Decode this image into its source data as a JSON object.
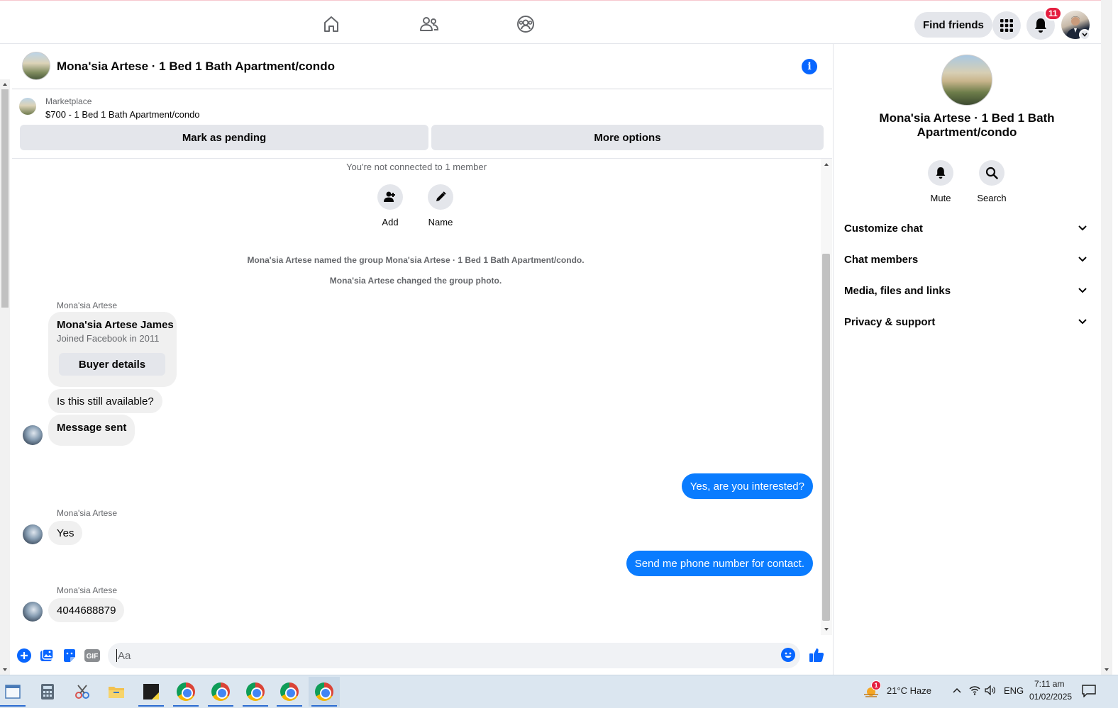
{
  "topnav": {
    "find_friends": "Find friends",
    "notification_count": "11"
  },
  "chat": {
    "title": "Mona'sia Artese · 1 Bed 1 Bath Apartment/condo",
    "marketplace_label": "Marketplace",
    "listing": "$700 - 1 Bed 1 Bath Apartment/condo",
    "mark_pending": "Mark as pending",
    "more_options": "More options",
    "not_connected": "You're not connected to 1 member",
    "add_label": "Add",
    "name_label": "Name",
    "system_messages": [
      "Mona'sia Artese named the group Mona'sia Artese · 1 Bed 1 Bath Apartment/condo.",
      "Mona'sia Artese changed the group photo."
    ],
    "sender_name": "Mona'sia Artese",
    "buyer_card": {
      "name": "Mona'sia Artese James",
      "joined": "Joined Facebook in 2011",
      "button": "Buyer details"
    },
    "messages": [
      {
        "from": "them",
        "text": "Is this still available?"
      },
      {
        "from": "them",
        "text": "Message sent"
      },
      {
        "from": "me",
        "text": "Yes, are you interested?"
      },
      {
        "from": "them",
        "text": "Yes"
      },
      {
        "from": "me",
        "text": "Send me phone number for contact."
      },
      {
        "from": "them",
        "text": "4044688879"
      }
    ],
    "composer_placeholder": "Aa"
  },
  "right_panel": {
    "title": "Mona'sia Artese · 1 Bed 1 Bath Apartment/condo",
    "mute": "Mute",
    "search": "Search",
    "sections": [
      "Customize chat",
      "Chat members",
      "Media, files and links",
      "Privacy & support"
    ]
  },
  "taskbar": {
    "weather_badge": "1",
    "weather": "21°C  Haze",
    "language": "ENG",
    "time": "7:11 am",
    "date": "01/02/2025"
  },
  "colors": {
    "accent": "#0866ff",
    "outgoing_bubble": "#0a7cff",
    "incoming_bubble": "#f0f0f0",
    "badge": "#e41e3f"
  }
}
